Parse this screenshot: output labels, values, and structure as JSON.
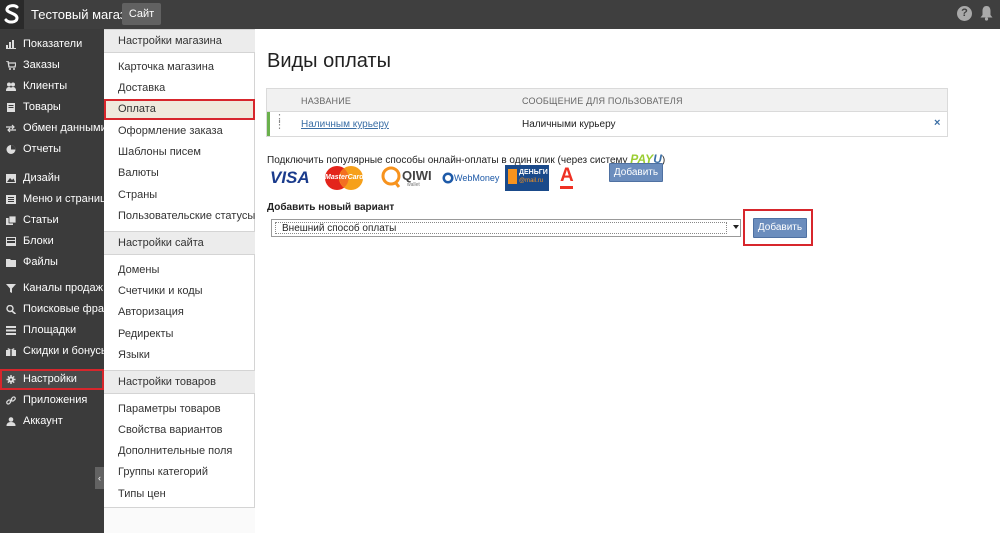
{
  "topbar": {
    "shop_name": "Тестовый магазин",
    "site_button": "Сайт",
    "help_glyph": "?"
  },
  "sidebar": {
    "items": [
      {
        "label": "Показатели",
        "icon": "bar-chart-icon"
      },
      {
        "label": "Заказы",
        "icon": "cart-icon"
      },
      {
        "label": "Клиенты",
        "icon": "users-icon"
      },
      {
        "label": "Товары",
        "icon": "book-icon"
      },
      {
        "label": "Обмен данными",
        "icon": "exchange-icon"
      },
      {
        "label": "Отчеты",
        "icon": "pie-chart-icon"
      },
      {
        "label": "Дизайн",
        "icon": "image-icon"
      },
      {
        "label": "Меню и страницы",
        "icon": "menu-icon"
      },
      {
        "label": "Статьи",
        "icon": "articles-icon"
      },
      {
        "label": "Блоки",
        "icon": "blocks-icon"
      },
      {
        "label": "Файлы",
        "icon": "folder-icon"
      },
      {
        "label": "Каналы продаж",
        "icon": "funnel-icon"
      },
      {
        "label": "Поисковые фразы",
        "icon": "search-icon"
      },
      {
        "label": "Площадки",
        "icon": "list-icon"
      },
      {
        "label": "Скидки и бонусы",
        "icon": "gift-icon"
      },
      {
        "label": "Настройки",
        "icon": "gear-icon",
        "active": true
      },
      {
        "label": "Приложения",
        "icon": "link-icon"
      },
      {
        "label": "Аккаунт",
        "icon": "user-icon"
      }
    ],
    "collapse_glyph": "‹"
  },
  "submenu": {
    "sections": [
      {
        "title": "Настройки магазина",
        "items": [
          "Карточка магазина",
          "Доставка",
          "Оплата",
          "Оформление заказа",
          "Шаблоны писем",
          "Валюты",
          "Страны",
          "Пользовательские статусы"
        ]
      },
      {
        "title": "Настройки сайта",
        "items": [
          "Домены",
          "Счетчики и коды",
          "Авторизация",
          "Редиректы",
          "Языки"
        ]
      },
      {
        "title": "Настройки товаров",
        "items": [
          "Параметры товаров",
          "Свойства вариантов",
          "Дополнительные поля",
          "Группы категорий",
          "Типы цен"
        ]
      }
    ],
    "active_item": "Оплата"
  },
  "main": {
    "title": "Виды оплаты",
    "table": {
      "col_name": "НАЗВАНИЕ",
      "col_message": "СООБЩЕНИЕ ДЛЯ ПОЛЬЗОВАТЕЛЯ",
      "rows": [
        {
          "name": "Наличным курьеру",
          "message": "Наличными курьеру"
        }
      ],
      "delete_glyph": "×"
    },
    "connect_text": "Подключить популярные способы онлайн-оплаты в один клик (через систему",
    "payu_pay": "PAY",
    "payu_u": "U",
    "payu_close": ")",
    "logos": [
      "VISA",
      "MasterCard",
      "QIWI",
      "WebMoney",
      "Деньги@Mail.Ru",
      "Альфа-Банк"
    ],
    "logo_text": {
      "visa": "VISA",
      "mastercard": "MasterCard",
      "qiwi": "QIWI",
      "qiwi_sub": "wallet",
      "webmoney": "WebMoney",
      "dengi": "ДЕНЬГИ",
      "mailru": "@mail.ru",
      "alfa": "А"
    },
    "add_top_label": "Добавить",
    "new_variant_label": "Добавить новый вариант",
    "select_value": "Внешний способ оплаты",
    "add_main_label": "Добавить"
  },
  "colors": {
    "highlight": "#d7262c",
    "button": "#6b8dbd",
    "sidebar_bg": "#3b3b3b",
    "topbar_bg": "#3f3f3f"
  }
}
